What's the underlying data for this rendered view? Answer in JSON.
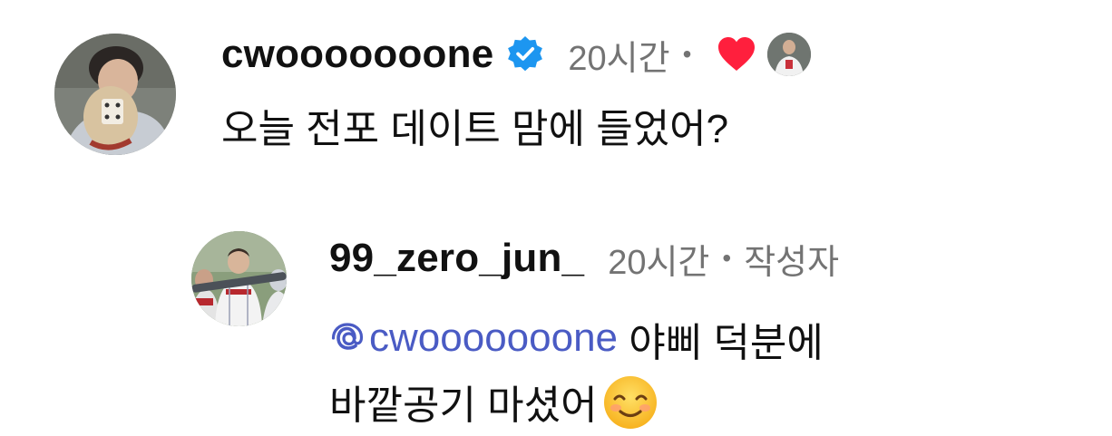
{
  "comment": {
    "username": "cwooooooone",
    "verified": true,
    "time": "20시간",
    "separator": "•",
    "text": "오늘 전포 데이트 맘에 들었어?",
    "liked_by_author": true,
    "avatar_icon": "baseball-glove-portrait",
    "colors": {
      "username": "#111111",
      "meta": "#737373",
      "verified_badge": "#1d96f0",
      "heart": "#ff1f3d"
    }
  },
  "reply": {
    "username": "99_zero_jun_",
    "time": "20시간",
    "separator": "•",
    "author_tag": "작성자",
    "mention": "cwooooooone",
    "text_after_mention": " 야삐 덕분에",
    "text_line2": "바깥공기 마셨어",
    "emoji": "smiling-face-emoji",
    "avatar_icon": "baseball-uniform-portrait",
    "colors": {
      "mention": "#4a5bc4"
    }
  }
}
